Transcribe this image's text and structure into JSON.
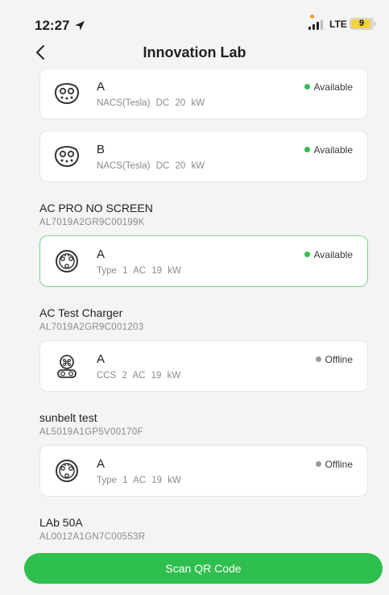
{
  "status_bar": {
    "time": "12:27",
    "network": "LTE",
    "battery_level": "9"
  },
  "header": {
    "title": "Innovation Lab",
    "back_icon": "chevron-left-icon"
  },
  "colors": {
    "available": "#2fbf4e",
    "offline": "#9b9b9b",
    "accent": "#2fbf4e",
    "selected_border": "#7ed08a"
  },
  "top_connectors": [
    {
      "name": "A",
      "type": "NACS(Tesla)",
      "current": "DC",
      "power": "20 kW",
      "status": "Available",
      "icon": "nacs-plug-icon"
    },
    {
      "name": "B",
      "type": "NACS(Tesla)",
      "current": "DC",
      "power": "20 kW",
      "status": "Available",
      "icon": "nacs-plug-icon"
    }
  ],
  "chargers": [
    {
      "name": "AC PRO NO SCREEN",
      "serial": "AL7019A2GR9C00199K",
      "connectors": [
        {
          "name": "A",
          "type": "Type 1",
          "current": "AC",
          "power": "19 kW",
          "status": "Available",
          "icon": "type1-plug-icon"
        }
      ]
    },
    {
      "name": "AC Test Charger",
      "serial": "AL7019A2GR9C001203",
      "connectors": [
        {
          "name": "A",
          "type": "CCS 2",
          "current": "AC",
          "power": "19 kW",
          "status": "Offline",
          "icon": "ccs2-plug-icon"
        }
      ]
    },
    {
      "name": "sunbelt test",
      "serial": "AL5019A1GP5V00170F",
      "connectors": [
        {
          "name": "A",
          "type": "Type 1",
          "current": "AC",
          "power": "19 kW",
          "status": "Offline",
          "icon": "type1-plug-icon"
        }
      ]
    },
    {
      "name": "LAb 50A",
      "serial": "AL0012A1GN7C00553R",
      "connectors": []
    }
  ],
  "scan_button": {
    "label": "Scan QR Code"
  }
}
